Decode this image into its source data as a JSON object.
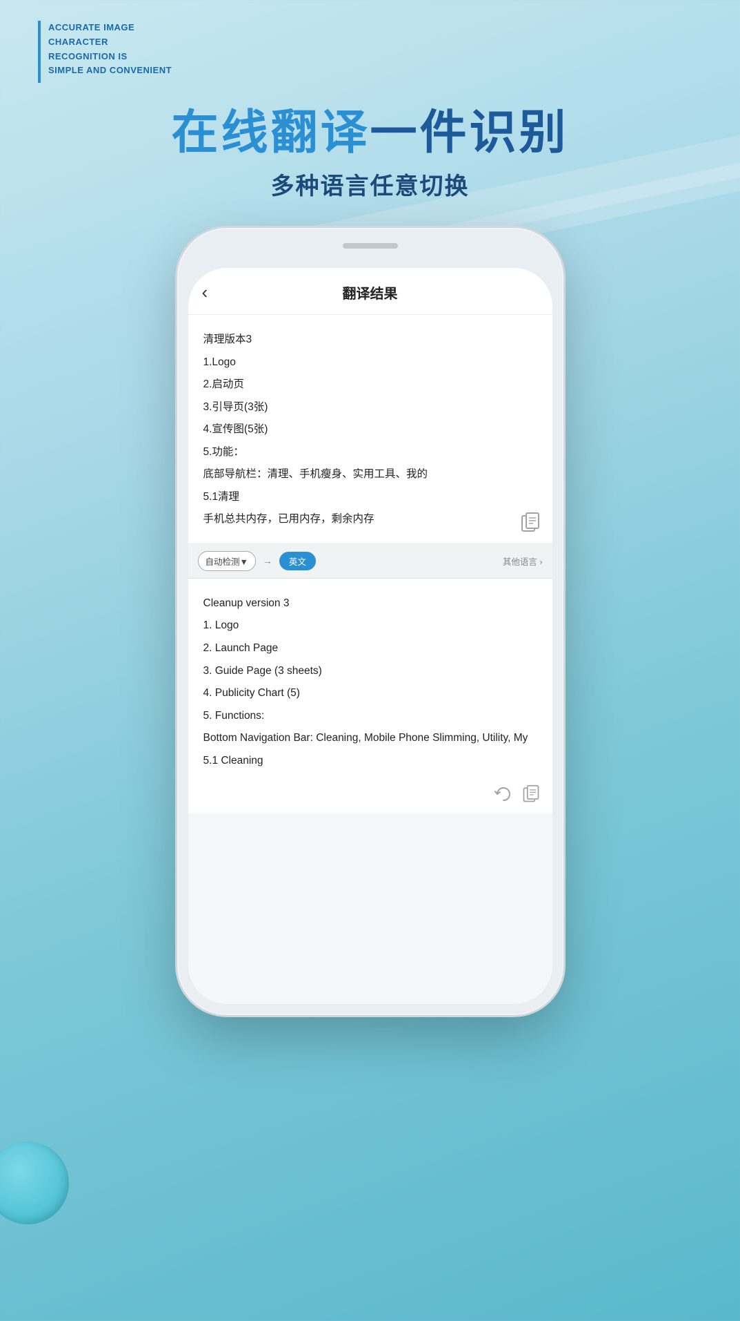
{
  "background": {
    "gradient_start": "#c8e8f0",
    "gradient_end": "#5ab8cc"
  },
  "tagline": {
    "line1": "ACCURATE IMAGE",
    "line2": "CHARACTER",
    "line3": "RECOGNITION IS",
    "line4": "SIMPLE AND CONVENIENT"
  },
  "hero": {
    "title_part1": "在线翻译",
    "title_part2": "一件识别",
    "subtitle": "多种语言任意切换"
  },
  "phone": {
    "screen_title": "翻译结果",
    "back_label": "‹",
    "chinese_lines": [
      "清理版本3",
      "1.Logo",
      "2.启动页",
      "3.引导页(3张)",
      "4.宣传图(5张)",
      "5.功能：",
      "底部导航栏：清理、手机瘦身、实用工具、我的",
      "5.1清理",
      "手机总共内存，已用内存，剩余内存"
    ],
    "toolbar": {
      "auto_detect": "自动检测▼",
      "arrow": "→",
      "target_lang": "英文",
      "other_lang": "其他语言 ›"
    },
    "english_lines": [
      "Cleanup version 3",
      "1. Logo",
      "2. Launch Page",
      "3. Guide Page (3 sheets)",
      "4. Publicity Chart (5)",
      "5. Functions:",
      "Bottom Navigation Bar: Cleaning, Mobile Phone Slimming, Utility, My",
      "5.1 Cleaning"
    ]
  }
}
